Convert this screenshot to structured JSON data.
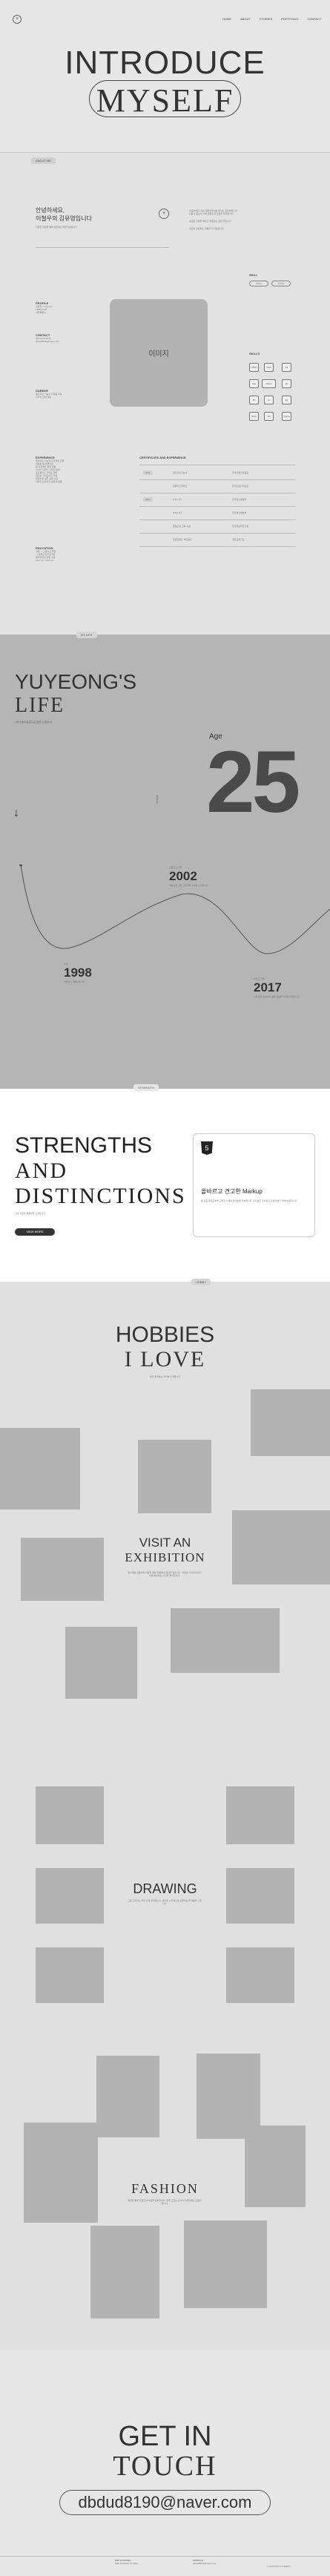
{
  "header": {
    "logo": "Y",
    "nav": [
      "HOME",
      "ABOUT",
      "STORIES",
      "PORTFOLIO",
      "CONTACT"
    ]
  },
  "hero": {
    "title_line1": "INTRODUCE",
    "title_line2": "MYSELF"
  },
  "about": {
    "tag": "ABOUT ME",
    "intro_line1": "안녕하세요,",
    "intro_line2": "이철우의 김유영입니다",
    "intro_sub": "다양한 경험을 통해 성장하는 퍼블리셔입니다",
    "badge": "Y",
    "desc": [
      "안녕하세요! 저는 웹퍼블리셔를 꿈꾸는 김유영입니다.",
      "사용자 중심의 UI와 깔끔한 마크업을 지향합니다.",
      "새로운 기술을 배우고 적용하는 것을 즐깁니다.",
      "꾸준히 성장하는 개발자가 되겠습니다."
    ],
    "profile_label": "PROFILE",
    "profile_lines": [
      "김유영 / Yuyeong",
      "1998.02.25",
      "서울특별시"
    ],
    "contact_label": "CONTACT",
    "contact_lines": [
      "010-1234-5678",
      "dbdud8190@naver.com"
    ],
    "career_label": "CAREER",
    "career_lines": [
      "웹디자인 기능사 자격증 취득",
      "디자인 관련 활동"
    ],
    "photo_label": "이미지",
    "skill_label": "SKILL",
    "skill_pills": [
      "TOOL",
      "CODE"
    ],
    "skills_label": "SKILLS",
    "skills": [
      "HTML",
      "CSS",
      "JS",
      "Vue",
      "React",
      "jQ",
      "Ps",
      "Ai",
      "Fg",
      "Sass",
      "Git",
      "Figma"
    ],
    "experience_label": "EXPERIENCE",
    "experience_lines": [
      "웹사이트 리뉴얼 프로젝트 진행",
      "반응형 웹 퍼블리싱",
      "팀 프로젝트 협업 경험",
      "UI/UX 디자인 스터디 참여",
      "포트폴리오 사이트 제작",
      "접근성 가이드라인 학습",
      "퍼블리싱 실무 교육 수료",
      "다양한 브라우저 호환성 대응"
    ],
    "education_label": "EDUCATION",
    "education_lines": [
      "서울 ○○고등학교 졸업",
      "○○대학교 디자인학과",
      "웹퍼블리셔 과정 수료",
      "2017.03 - 2021.02"
    ],
    "history_label": "CERTIFICATE AND EXPERIENCE",
    "history_rows": [
      {
        "year": "2021",
        "a": "웹디자인기능사",
        "b": "한국산업인력공단"
      },
      {
        "year": "",
        "a": "컴퓨터그래픽스",
        "b": "한국산업인력공단"
      },
      {
        "year": "2022",
        "a": "GTQ 1급",
        "b": "한국생산성본부"
      },
      {
        "year": "",
        "a": "GTQi 1급",
        "b": "한국생산성본부"
      },
      {
        "year": "",
        "a": "웹접근성 교육 수료",
        "b": "한국정보화진흥원"
      },
      {
        "year": "",
        "a": "프론트엔드 부트캠프",
        "b": "코딩교육기관"
      }
    ]
  },
  "life": {
    "tag": "MY LIFE",
    "title_line1": "YUYEONG'S",
    "title_line2": "LIFE",
    "subtitle": "나의 인생의 중요한 순간들을 소개합니다",
    "age_label": "Age",
    "age": "25",
    "scroll_label": "SCROLL",
    "events": [
      {
        "year": "2002",
        "label": "초등학교 입학",
        "desc": "처음으로 그림 그리기에 흥미를 느꼈습니다"
      },
      {
        "year": "1998",
        "label": "출생",
        "desc": "서울에서 태어났습니다"
      },
      {
        "year": "2017",
        "label": "대학교 입학",
        "desc": "디자인을 전공하며 웹에 관심을 가지게 되었습니다"
      }
    ]
  },
  "strengths": {
    "tag": "STRENGTH",
    "title_line1": "STRENGTHS",
    "title_line2": "AND",
    "title_line3": "DISTINCTIONS",
    "subtitle": "나의 강점과 특별함을 소개합니다",
    "button": "VIEW MORE",
    "card_icon": "5",
    "card_title": "올바르고 견고한 Markup",
    "card_desc": "웹 표준과 접근성을 고려한 시맨틱 마크업을 작성합니다. 유지보수가 쉬운 구조를 만들기 위해 노력합니다."
  },
  "hobbies": {
    "tag": "HOBBY",
    "title_line1": "HOBBIES",
    "title_line2": "I LOVE",
    "subtitle": "제가 좋아하는 취미를 소개합니다",
    "exhibition_title1": "VISIT AN",
    "exhibition_title2": "EXHIBITION",
    "exhibition_desc": "전시회를 관람하며 다양한 예술 작품에서 영감을 얻습니다. 새로운 시각과 아이디어를 발견하는 시간을 좋아합니다.",
    "drawing_title": "DRAWING",
    "drawing_desc": "그림 그리기는 저의 오랜 취미입니다. 생각을 시각적으로 표현하는 즐거움을 느낍니다.",
    "fashion_title": "FASHION",
    "fashion_desc": "패션을 통해 트렌드와 색감을 공부합니다. 옷을 고르는 감각이 디자인에도 도움이 됩니다."
  },
  "contact": {
    "title_line1": "GET IN",
    "title_line2": "TOUCH",
    "email": "dbdud8190@naver.com"
  },
  "footer": {
    "col1_title": "KIM YUYEONG",
    "col1_line": "Web Publisher Portfolio",
    "col2_title": "CONTACT",
    "col2_line": "dbdud8190@naver.com",
    "copyright": "© 2023 KIM YUYEONG"
  }
}
